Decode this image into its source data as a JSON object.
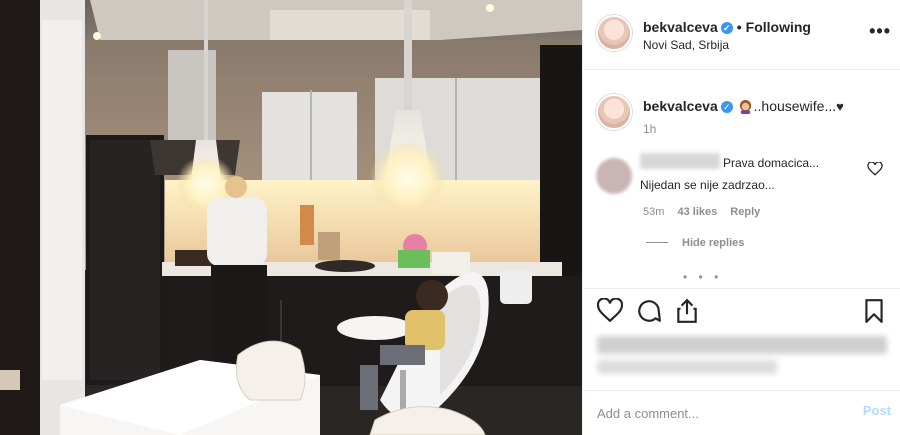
{
  "post": {
    "username": "bekvalceva",
    "verified_badge": "✓",
    "separator": "•",
    "follow_status": "Following",
    "location": "Novi Sad, Srbija",
    "more_icon": "ellipsis-icon",
    "more_label": "•••"
  },
  "caption": {
    "username": "bekvalceva",
    "text": "..housewife...",
    "heart": "♥",
    "time": "1h"
  },
  "comment": {
    "line1": "Prava domacica...",
    "line2": "Nijedan se nije zadrzao...",
    "time": "53m",
    "likes": "43 likes",
    "reply": "Reply"
  },
  "hide_replies": "Hide replies",
  "loading_dots": "• • •",
  "add_comment": {
    "placeholder": "Add a comment...",
    "post_label": "Post"
  },
  "colors": {
    "accent": "#3897f0",
    "post_disabled": "#b3dbff",
    "muted": "#8e8e8e"
  }
}
